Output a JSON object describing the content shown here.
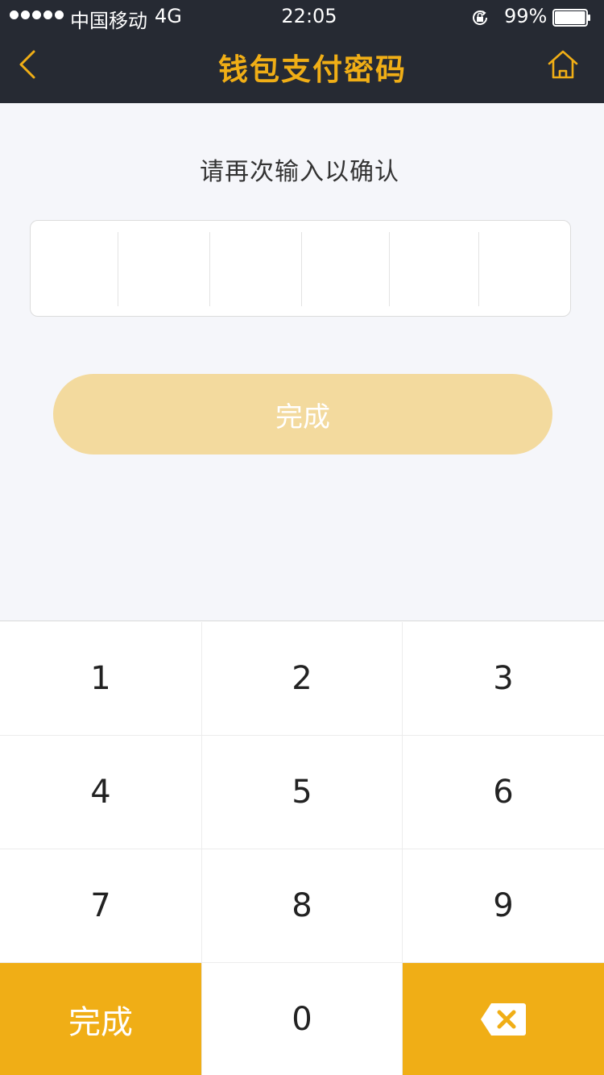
{
  "status_bar": {
    "carrier": "中国移动",
    "network": "4G",
    "time": "22:05",
    "battery_percent": "99%",
    "battery_level": 0.99
  },
  "header": {
    "title": "钱包支付密码",
    "back_icon": "chevron-left-icon",
    "home_icon": "home-icon"
  },
  "prompt": "请再次输入以确认",
  "pin": {
    "length": 6,
    "entered": 0
  },
  "done_button": {
    "label": "完成"
  },
  "keypad": {
    "keys": [
      "1",
      "2",
      "3",
      "4",
      "5",
      "6",
      "7",
      "8",
      "9"
    ],
    "zero": "0",
    "done_label": "完成",
    "delete_icon": "backspace-icon"
  },
  "colors": {
    "accent": "#f0ae16",
    "header_bg": "#262a33",
    "button_disabled": "#f3da9e",
    "page_bg": "#f5f6fa"
  }
}
